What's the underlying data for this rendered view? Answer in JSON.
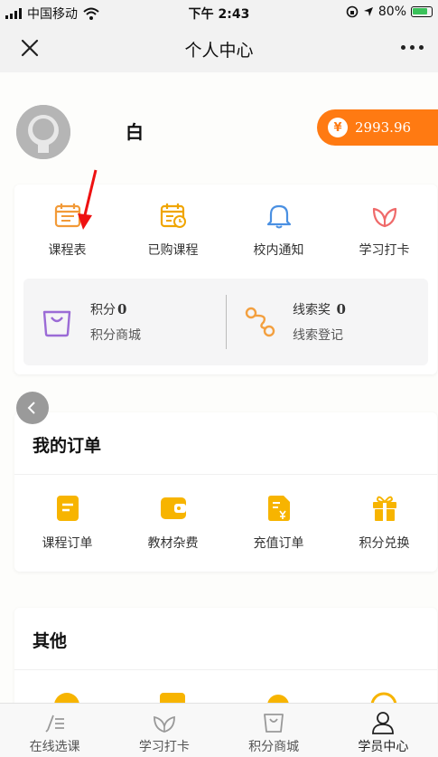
{
  "status_bar": {
    "carrier": "中国移动",
    "time": "下午 2:43",
    "battery": "80%"
  },
  "nav": {
    "title": "个人中心",
    "close_icon": "close-icon",
    "more_icon": "more-icon"
  },
  "profile": {
    "username": "白",
    "balance": "2993.96",
    "coin_symbol": "¥"
  },
  "quick_menu": {
    "items": [
      {
        "label": "课程表",
        "icon": "calendar-icon",
        "color": "#f29a38"
      },
      {
        "label": "已购课程",
        "icon": "calendar-clock-icon",
        "color": "#f0a500"
      },
      {
        "label": "校内通知",
        "icon": "bell-icon",
        "color": "#4a90e2"
      },
      {
        "label": "学习打卡",
        "icon": "leaf-icon",
        "color": "#ef6a6a"
      }
    ]
  },
  "points": {
    "points_label": "积分",
    "points_value": "0",
    "points_mall": "积分商城",
    "clue_label": "线索奖",
    "clue_value": "0",
    "clue_register": "线索登记"
  },
  "orders": {
    "title": "我的订单",
    "items": [
      {
        "label": "课程订单",
        "icon": "order-icon"
      },
      {
        "label": "教材杂费",
        "icon": "wallet-icon"
      },
      {
        "label": "充值订单",
        "icon": "recharge-icon"
      },
      {
        "label": "积分兑换",
        "icon": "gift-icon"
      }
    ]
  },
  "other": {
    "title": "其他"
  },
  "tabbar": {
    "items": [
      {
        "label": "在线选课",
        "icon": "pen-list-icon"
      },
      {
        "label": "学习打卡",
        "icon": "leaf-icon"
      },
      {
        "label": "积分商城",
        "icon": "bag-icon"
      },
      {
        "label": "学员中心",
        "icon": "person-icon"
      }
    ]
  },
  "colors": {
    "accent": "#ff7a12",
    "order_icons": "#f7b400",
    "points_purple": "#9b6bd6",
    "clue_orange": "#f3a040"
  }
}
